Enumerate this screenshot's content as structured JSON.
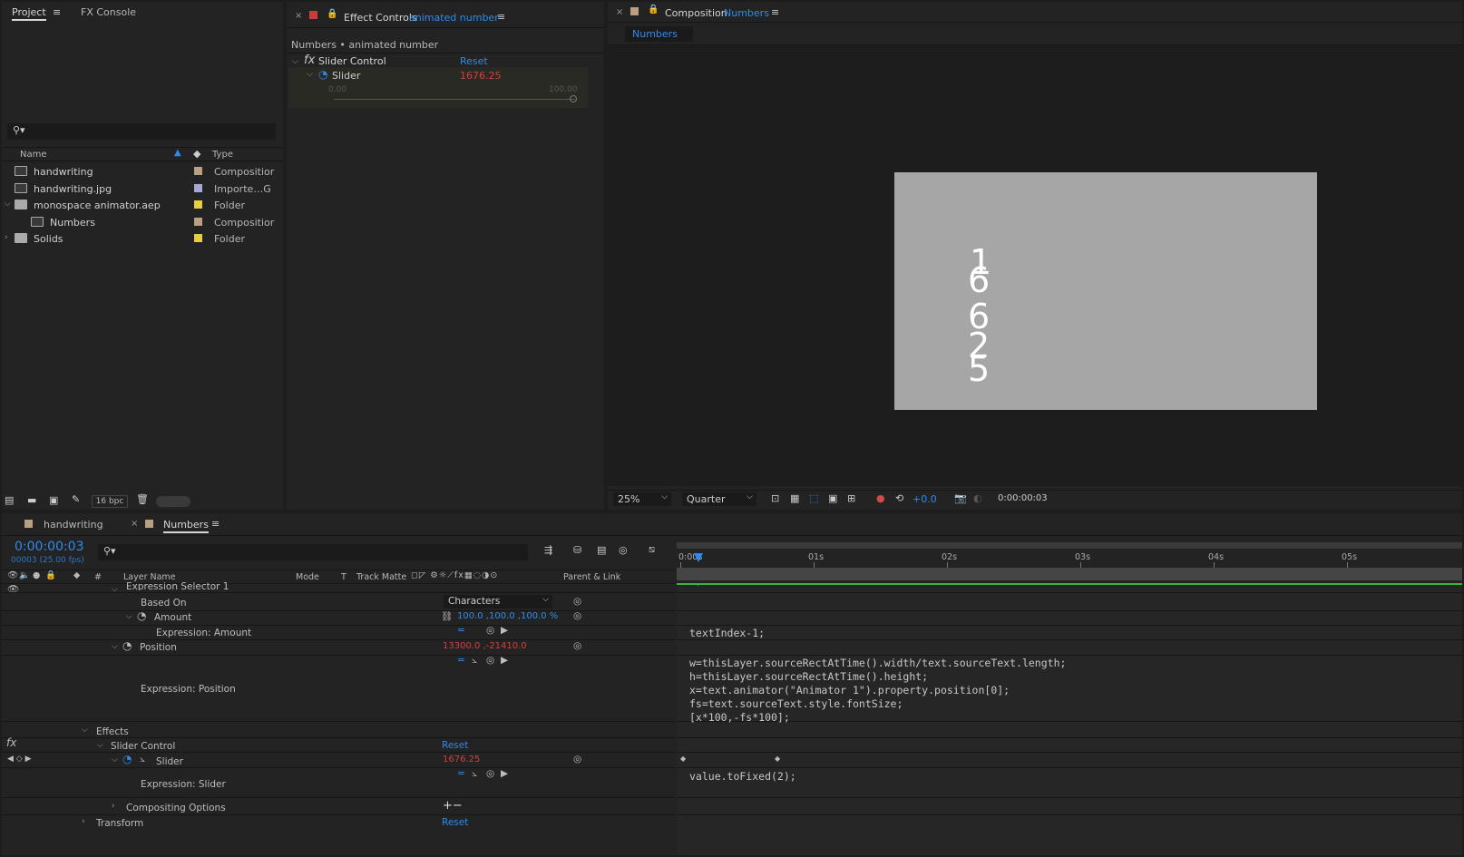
{
  "project_panel": {
    "tabs": [
      "Project",
      "FX Console"
    ],
    "search_placeholder": "",
    "columns": {
      "name": "Name",
      "type": "Type"
    },
    "items": [
      {
        "name": "handwriting",
        "type": "Compositior",
        "color": "#b9a083",
        "icon": "composition-icon"
      },
      {
        "name": "handwriting.jpg",
        "type": "Importe…G",
        "color": "#a7a7d8",
        "icon": "image-file-icon"
      },
      {
        "name": "monospace animator.aep",
        "type": "Folder",
        "color": "#e6cf3e",
        "icon": "folder-icon"
      },
      {
        "name": "Numbers",
        "type": "Compositior",
        "color": "#b9a083",
        "icon": "composition-icon"
      },
      {
        "name": "Solids",
        "type": "Folder",
        "color": "#e6cf3e",
        "icon": "folder-icon"
      }
    ],
    "bpc": "16 bpc"
  },
  "effect_controls": {
    "title": "Effect Controls",
    "title_link": "animated number",
    "breadcrumb": "Numbers • animated number",
    "effect_name": "Slider Control",
    "reset": "Reset",
    "param_name": "Slider",
    "param_value": "1676.25",
    "slider_min": "0.00",
    "slider_max": "100.00"
  },
  "composition": {
    "title": "Composition",
    "title_link": "Numbers",
    "tab": "Numbers",
    "digits": [
      "1",
      "6",
      "6",
      "2",
      "5"
    ],
    "zoom": "25%",
    "resolution": "Quarter",
    "exposure": "+0.0",
    "timecode": "0:00:00:03"
  },
  "timeline": {
    "tabs": [
      "handwriting",
      "Numbers"
    ],
    "timecode": "0:00:00:03",
    "frame_info": "00003 (25.00 fps)",
    "columns": {
      "layer_name": "Layer Name",
      "mode": "Mode",
      "t": "T",
      "track_matte": "Track Matte",
      "parent": "Parent & Link",
      "num": "#"
    },
    "ruler": [
      "0:00s",
      "01s",
      "02s",
      "03s",
      "04s",
      "05s"
    ],
    "rows": {
      "expr_selector": "Expression Selector 1",
      "based_on": "Based On",
      "based_on_value": "Characters",
      "amount": "Amount",
      "amount_value": "100.0 ,100.0 ,100.0 %",
      "expr_amount": "Expression: Amount",
      "position": "Position",
      "position_value": "13300.0 ,-21410.0",
      "expr_position": "Expression: Position",
      "effects": "Effects",
      "slider_control": "Slider Control",
      "reset": "Reset",
      "slider": "Slider",
      "slider_value": "1676.25",
      "expr_slider": "Expression: Slider",
      "compositing": "Compositing Options",
      "plus_minus": "+−",
      "transform": "Transform",
      "transform_reset": "Reset"
    },
    "code": {
      "amount": "textIndex-1;",
      "position": [
        "w=thisLayer.sourceRectAtTime().width/text.sourceText.length;",
        "h=thisLayer.sourceRectAtTime().height;",
        "x=text.animator(\"Animator 1\").property.position[0];",
        "fs=text.sourceText.style.fontSize;",
        "[x*100,-fs*100];"
      ],
      "slider": "value.toFixed(2);"
    }
  },
  "colors": {
    "accent": "#2d8ceb",
    "value_red": "#d93d3d",
    "work_area": "#3cb43c"
  }
}
